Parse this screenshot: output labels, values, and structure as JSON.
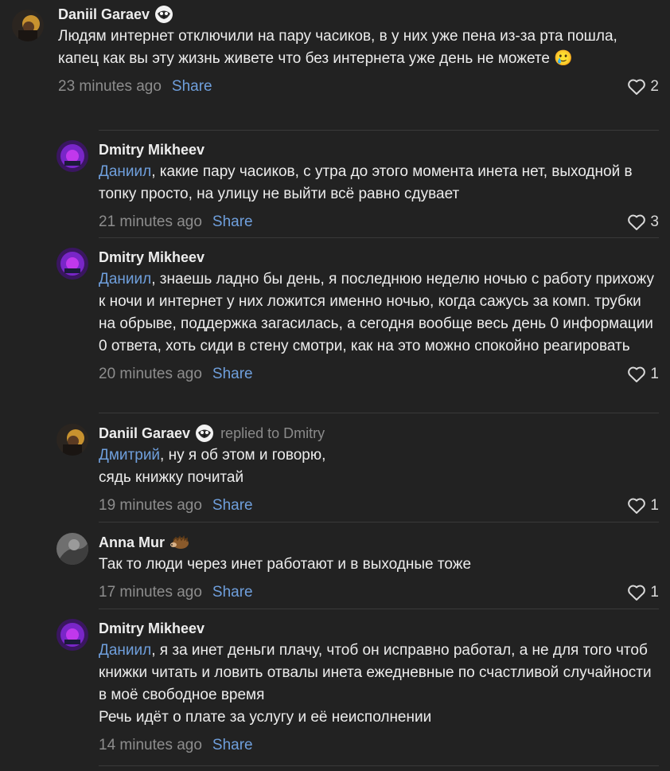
{
  "comments": [
    {
      "author": "Daniil Garaev",
      "replied": "",
      "mention": "",
      "lines": [
        "Людям интернет отключили на пару часиков, в у них уже пена из-за рта пошла, капец как вы эту жизнь живете что без интернета уже день не можете 🥲"
      ],
      "time": "23 minutes ago",
      "share": "Share",
      "likes": "2"
    },
    {
      "author": "Dmitry Mikheev",
      "replied": "",
      "mention": "Даниил",
      "lines": [
        ", какие пару часиков, с утра до этого момента инета нет, выходной в топку просто, на улицу не выйти всё равно сдувает"
      ],
      "time": "21 minutes ago",
      "share": "Share",
      "likes": "3"
    },
    {
      "author": "Dmitry Mikheev",
      "replied": "",
      "mention": "Даниил",
      "lines": [
        ", знаешь ладно бы день, я последнюю неделю ночью с работу прихожу к ночи и интернет у них ложится именно ночью, когда сажусь за комп. трубки на обрыве, поддержка загасилась, а сегодня вообще весь день 0 информации 0 ответа, хоть сиди в стену смотри, как на это можно спокойно реагировать"
      ],
      "time": "20 minutes ago",
      "share": "Share",
      "likes": "1"
    },
    {
      "author": "Daniil Garaev",
      "replied": "replied to Dmitry",
      "mention": "Дмитрий",
      "lines": [
        ", ну я об этом и говорю,",
        "сядь книжку почитай"
      ],
      "time": "19 minutes ago",
      "share": "Share",
      "likes": "1"
    },
    {
      "author": "Anna Mur",
      "replied": "",
      "mention": "",
      "lines": [
        "Так то люди через инет работают и в выходные тоже"
      ],
      "time": "17 minutes ago",
      "share": "Share",
      "likes": "1"
    },
    {
      "author": "Dmitry Mikheev",
      "replied": "",
      "mention": "Даниил",
      "lines": [
        ", я за инет деньги плачу, чтоб он исправно работал, а не для того чтоб книжки читать и ловить отвалы инета ежедневные по счастливой случайности в моё свободное время",
        "Речь идёт о плате за услугу и её неисполнении"
      ],
      "time": "14 minutes ago",
      "share": "Share",
      "likes": ""
    }
  ],
  "colors": {
    "background": "#222222",
    "accent": "#6f9fdc",
    "muted": "#8d8d8d"
  },
  "icons": [
    "heart-icon",
    "raccoon-badge-icon",
    "hedgehog-badge-icon"
  ]
}
